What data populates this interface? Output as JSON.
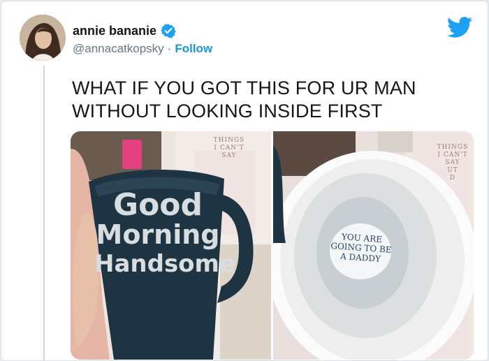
{
  "author": {
    "name": "annie bananie",
    "handle": "@annacatkopsky",
    "separator": "·",
    "follow_label": "Follow",
    "verified": true
  },
  "brand": {
    "icon": "twitter-bird-icon",
    "color": "#1da1f2"
  },
  "tweet": {
    "text_line1": "WHAT IF YOU GOT THIS FOR UR MAN",
    "text_line2": "WITHOUT LOOKING INSIDE FIRST"
  },
  "media": {
    "left_photo": {
      "mug_line1": "Good",
      "mug_line2": "Morning",
      "mug_line3": "Handsome",
      "box_line1": "THINGS",
      "box_line2": "I CAN'T",
      "box_line3": "SAY"
    },
    "right_photo": {
      "inside_line1": "YOU ARE",
      "inside_line2": "GOING TO BE",
      "inside_line3": "A DADDY",
      "box_line1": "THINGS",
      "box_line2": "I CAN'T",
      "box_line3": "SAY",
      "box_line4": "UT",
      "box_line5": "D"
    }
  },
  "colors": {
    "text": "#14171a",
    "secondary": "#657786",
    "link": "#1b95e0",
    "mug": "#1f3443"
  }
}
